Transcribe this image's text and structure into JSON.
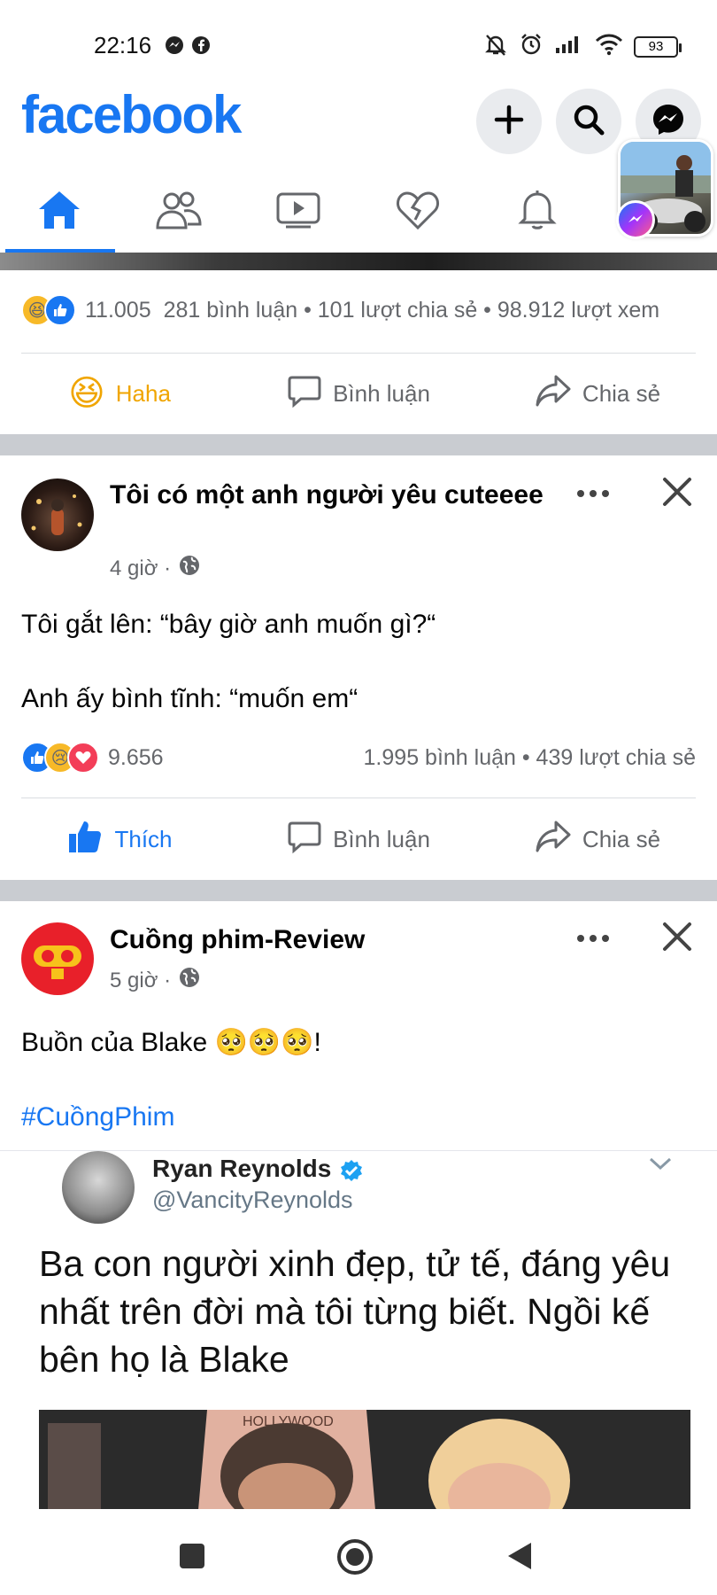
{
  "status_bar": {
    "time": "22:16",
    "battery": "93",
    "icons": [
      "messenger-icon",
      "facebook-icon",
      "mute-icon",
      "alarm-icon",
      "signal-icon",
      "wifi-icon",
      "battery-icon"
    ]
  },
  "header": {
    "logo": "facebook",
    "buttons": [
      "plus-icon",
      "search-icon",
      "messenger-icon"
    ],
    "brand_color": "#1877f2"
  },
  "nav": {
    "tabs": [
      "home-icon",
      "groups-icon",
      "watch-icon",
      "dating-icon",
      "notifications-icon",
      "menu-icon"
    ],
    "active": "home-icon"
  },
  "post1": {
    "reactions_count": "11.005",
    "stats": "281 bình luận • 101 lượt chia sẻ • 98.912 lượt xem",
    "actions": {
      "react_label": "Haha",
      "comment_label": "Bình luận",
      "share_label": "Chia sẻ"
    }
  },
  "post2": {
    "author": "Tôi có một anh người yêu cuteeee",
    "time": "4 giờ ·",
    "text_line1": "Tôi gắt lên: “bây giờ anh muốn gì?“",
    "text_line2": "Anh ấy bình tĩnh: “muốn em“",
    "reactions_count": "9.656",
    "stats": "1.995 bình luận • 439 lượt chia sẻ",
    "actions": {
      "like_label": "Thích",
      "comment_label": "Bình luận",
      "share_label": "Chia sẻ"
    }
  },
  "post3": {
    "author": "Cuồng phim-Review",
    "time": "5 giờ ·",
    "text": "Buồn của Blake 🥺🥺🥺!",
    "hashtag": "#CuồngPhim",
    "tweet": {
      "name": "Ryan Reynolds",
      "handle": "@VancityReynolds",
      "text": "Ba con người xinh đẹp, tử tế, đáng yêu nhất trên đời mà tôi từng biết. Ngồi kế bên họ là Blake",
      "photo_caption": "HOLLYWOOD"
    }
  },
  "bottom_nav": [
    "recent-apps-button",
    "home-button",
    "back-button"
  ]
}
